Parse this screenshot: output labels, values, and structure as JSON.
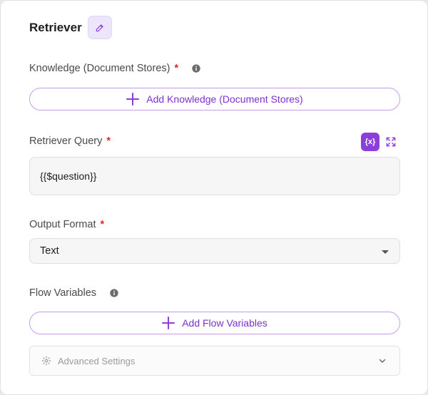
{
  "header": {
    "title": "Retriever"
  },
  "knowledge": {
    "label": "Knowledge (Document Stores)",
    "required_mark": "*",
    "add_label": "Add Knowledge (Document Stores)"
  },
  "query": {
    "label": "Retriever Query",
    "required_mark": "*",
    "variable_button": "{x}",
    "value": "{{$question}}"
  },
  "output": {
    "label": "Output Format",
    "required_mark": "*",
    "selected": "Text"
  },
  "flow_variables": {
    "label": "Flow Variables",
    "add_label": "Add Flow Variables"
  },
  "advanced": {
    "label": "Advanced Settings"
  },
  "colors": {
    "accent": "#8c3fd8",
    "accent_text": "#7f2fd1",
    "required": "#e0282e",
    "border_accent": "#c79ef0"
  }
}
